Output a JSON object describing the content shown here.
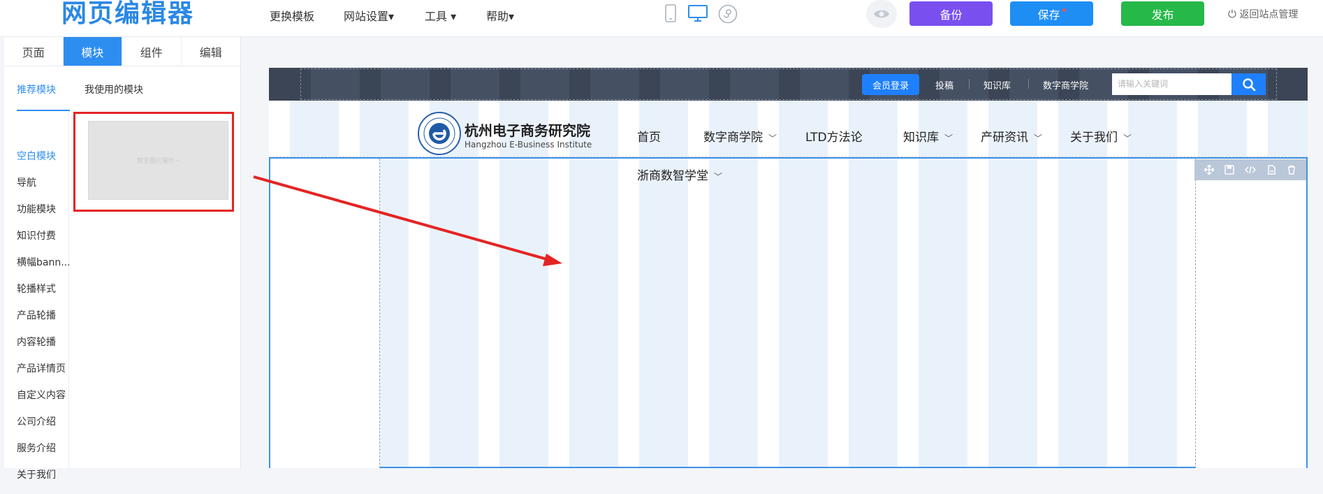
{
  "app": {
    "logo": "网页编辑器",
    "menu": [
      "更换模板",
      "网站设置▾",
      "工具 ▾",
      "帮助▾"
    ],
    "devices": [
      "mobile-icon",
      "desktop-icon",
      "mini-program-icon"
    ],
    "buttons": {
      "backup": "备份",
      "save": "保存",
      "publish": "发布",
      "back": "返回站点管理"
    },
    "colors": {
      "backup": "#7a4ff0",
      "save": "#1e8ef5",
      "publish": "#27b84a",
      "accent": "#2e8ef0"
    }
  },
  "panel": {
    "tabs": [
      "页面",
      "模块",
      "组件",
      "编辑"
    ],
    "subtabs": {
      "recommended": "推荐模块",
      "used": "我使用的模块"
    },
    "categories": [
      "空白模块",
      "导航",
      "功能模块",
      "知识付费",
      "横幅bann...",
      "轮播样式",
      "产品轮播",
      "内容轮播",
      "产品详情页",
      "自定义内容",
      "公司介绍",
      "服务介绍",
      "关于我们"
    ],
    "thumb_label": "暂无图片展示~"
  },
  "site": {
    "topbar": {
      "member_login": "会员登录",
      "links": [
        "投稿",
        "知识库",
        "数字商学院"
      ],
      "search_placeholder": "请输入关键词"
    },
    "brand": {
      "name": "杭州电子商务研究院",
      "sub": "Hangzhou E-Business Institute"
    },
    "nav": [
      {
        "label": "首页",
        "dropdown": false
      },
      {
        "label": "数字商学院",
        "dropdown": true
      },
      {
        "label": "LTD方法论",
        "dropdown": false
      },
      {
        "label": "知识库",
        "dropdown": true
      },
      {
        "label": "产研资讯",
        "dropdown": true
      },
      {
        "label": "关于我们",
        "dropdown": true
      },
      {
        "label": "浙商数智学堂",
        "dropdown": true
      }
    ],
    "module_tools": [
      "move-icon",
      "save-icon",
      "code-icon",
      "copy-icon",
      "delete-icon"
    ]
  }
}
